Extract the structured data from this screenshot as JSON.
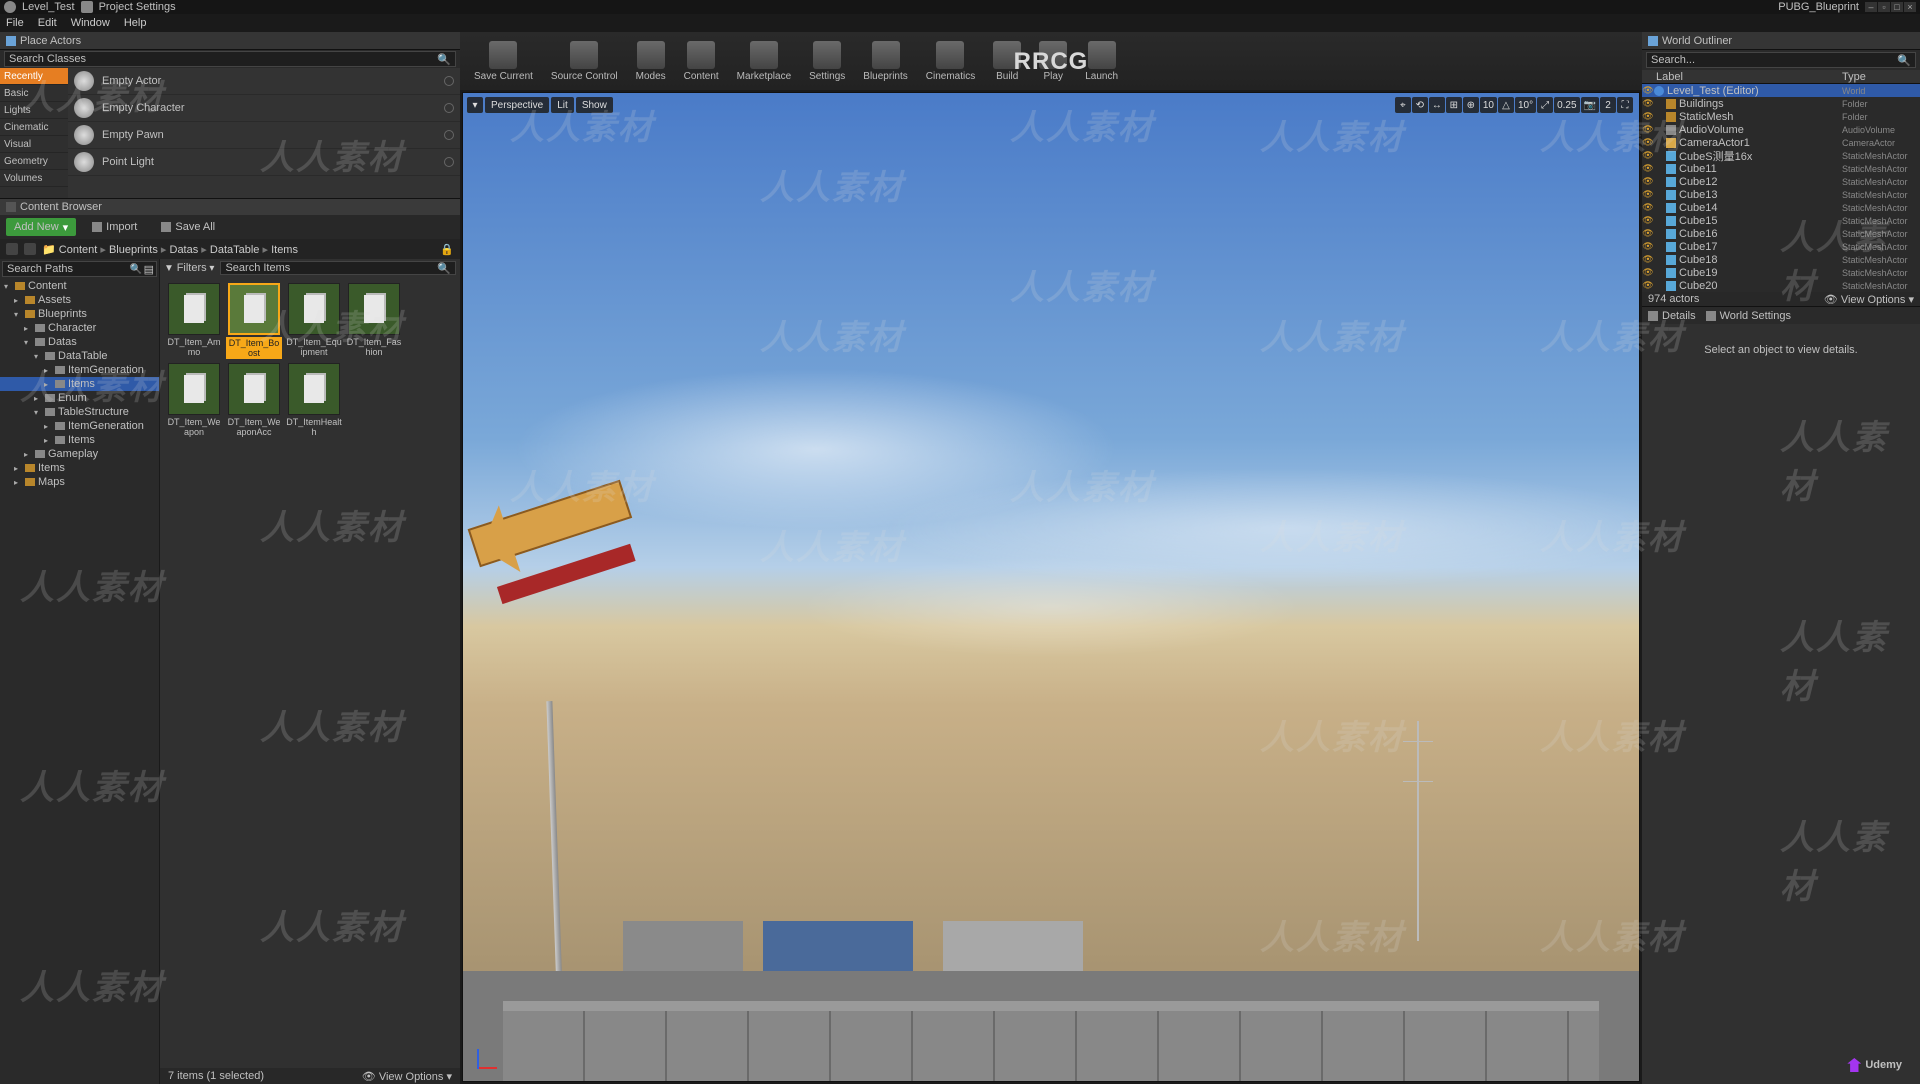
{
  "titlebar": {
    "left_tab": "Level_Test",
    "project_settings": "Project Settings",
    "right_tab": "PUBG_Blueprint"
  },
  "menubar": [
    "File",
    "Edit",
    "Window",
    "Help"
  ],
  "center_title": "RRCG",
  "place_actors": {
    "title": "Place Actors",
    "search_placeholder": "Search Classes",
    "categories": [
      "Recently Placed",
      "Basic",
      "Lights",
      "Cinematic",
      "Visual Effects",
      "Geometry",
      "Volumes"
    ],
    "active_category": "Recently Placed",
    "items": [
      "Empty Actor",
      "Empty Character",
      "Empty Pawn",
      "Point Light"
    ]
  },
  "content_browser": {
    "title": "Content Browser",
    "addnew": "Add New",
    "import": "Import",
    "saveall": "Save All",
    "breadcrumbs": [
      "Content",
      "Blueprints",
      "Datas",
      "DataTable",
      "Items"
    ],
    "tree_search_placeholder": "Search Paths",
    "filters_label": "Filters",
    "item_search_placeholder": "Search Items",
    "tree": [
      {
        "label": "Content",
        "indent": 0,
        "open": true,
        "folder": "gold"
      },
      {
        "label": "Assets",
        "indent": 1,
        "open": false,
        "folder": "gold"
      },
      {
        "label": "Blueprints",
        "indent": 1,
        "open": true,
        "folder": "gold"
      },
      {
        "label": "Character",
        "indent": 2,
        "open": false,
        "folder": "grey"
      },
      {
        "label": "Datas",
        "indent": 2,
        "open": true,
        "folder": "grey"
      },
      {
        "label": "DataTable",
        "indent": 3,
        "open": true,
        "folder": "grey"
      },
      {
        "label": "ItemGeneration",
        "indent": 4,
        "open": false,
        "folder": "grey"
      },
      {
        "label": "Items",
        "indent": 4,
        "open": false,
        "folder": "grey",
        "selected": true
      },
      {
        "label": "Enum",
        "indent": 3,
        "open": false,
        "folder": "grey"
      },
      {
        "label": "TableStructure",
        "indent": 3,
        "open": true,
        "folder": "grey"
      },
      {
        "label": "ItemGeneration",
        "indent": 4,
        "open": false,
        "folder": "grey"
      },
      {
        "label": "Items",
        "indent": 4,
        "open": false,
        "folder": "grey"
      },
      {
        "label": "Gameplay",
        "indent": 2,
        "open": false,
        "folder": "grey"
      },
      {
        "label": "Items",
        "indent": 1,
        "open": false,
        "folder": "gold"
      },
      {
        "label": "Maps",
        "indent": 1,
        "open": false,
        "folder": "gold"
      }
    ],
    "assets": [
      {
        "name": "DT_Item_Ammo"
      },
      {
        "name": "DT_Item_Boost",
        "selected": true
      },
      {
        "name": "DT_Item_Equipment"
      },
      {
        "name": "DT_Item_Fashion"
      },
      {
        "name": "DT_Item_Weapon"
      },
      {
        "name": "DT_Item_WeaponAcc"
      },
      {
        "name": "DT_ItemHealth"
      }
    ],
    "status": "7 items (1 selected)",
    "view_options": "View Options"
  },
  "main_toolbar": [
    "Save Current",
    "Source Control",
    "Modes",
    "Content",
    "Marketplace",
    "Settings",
    "Blueprints",
    "Cinematics",
    "Build",
    "Play",
    "Launch"
  ],
  "viewport": {
    "left_buttons": {
      "menu": "▾",
      "perspective": "Perspective",
      "lit": "Lit",
      "show": "Show"
    },
    "right_buttons": [
      "⌖",
      "⟲",
      "↔",
      "⊞",
      "⊕",
      "10",
      "△",
      "10°",
      "⤢",
      "0.25",
      "📷",
      "2",
      "⛶"
    ]
  },
  "world_outliner": {
    "title": "World Outliner",
    "search_placeholder": "Search...",
    "col_label": "Label",
    "col_type": "Type",
    "rows": [
      {
        "label": "Level_Test (Editor)",
        "type": "World",
        "icon": "world",
        "indent": 0,
        "sel": true
      },
      {
        "label": "Buildings",
        "type": "Folder",
        "icon": "folder",
        "indent": 1
      },
      {
        "label": "StaticMesh",
        "type": "Folder",
        "icon": "folder",
        "indent": 1
      },
      {
        "label": "AudioVolume",
        "type": "AudioVolume",
        "icon": "vol",
        "indent": 1
      },
      {
        "label": "CameraActor1",
        "type": "CameraActor",
        "icon": "cam",
        "indent": 1
      },
      {
        "label": "CubeS测量16x",
        "type": "StaticMeshActor",
        "icon": "mesh",
        "indent": 1
      },
      {
        "label": "Cube11",
        "type": "StaticMeshActor",
        "icon": "mesh",
        "indent": 1
      },
      {
        "label": "Cube12",
        "type": "StaticMeshActor",
        "icon": "mesh",
        "indent": 1
      },
      {
        "label": "Cube13",
        "type": "StaticMeshActor",
        "icon": "mesh",
        "indent": 1
      },
      {
        "label": "Cube14",
        "type": "StaticMeshActor",
        "icon": "mesh",
        "indent": 1
      },
      {
        "label": "Cube15",
        "type": "StaticMeshActor",
        "icon": "mesh",
        "indent": 1
      },
      {
        "label": "Cube16",
        "type": "StaticMeshActor",
        "icon": "mesh",
        "indent": 1
      },
      {
        "label": "Cube17",
        "type": "StaticMeshActor",
        "icon": "mesh",
        "indent": 1
      },
      {
        "label": "Cube18",
        "type": "StaticMeshActor",
        "icon": "mesh",
        "indent": 1
      },
      {
        "label": "Cube19",
        "type": "StaticMeshActor",
        "icon": "mesh",
        "indent": 1
      },
      {
        "label": "Cube20",
        "type": "StaticMeshActor",
        "icon": "mesh",
        "indent": 1
      }
    ],
    "footer_count": "974 actors",
    "view_options": "View Options"
  },
  "details": {
    "tab_details": "Details",
    "tab_world": "World Settings",
    "empty_text": "Select an object to view details."
  },
  "udemy": "Udemy",
  "watermark": "人人素材"
}
